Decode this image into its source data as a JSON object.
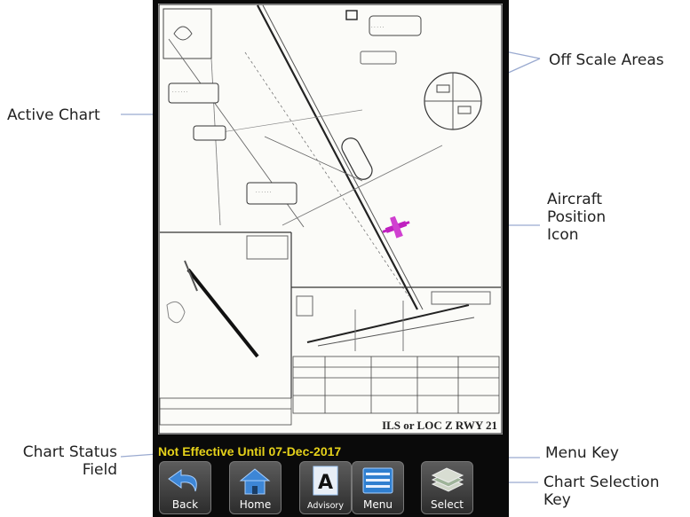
{
  "callouts": {
    "active_chart": "Active Chart",
    "off_scale_areas": "Off Scale Areas",
    "aircraft_position_icon": [
      "Aircraft",
      "Position",
      "Icon"
    ],
    "chart_status_field": [
      "Chart Status",
      "Field"
    ],
    "menu_key": "Menu Key",
    "chart_selection_key": [
      "Chart Selection",
      "Key"
    ]
  },
  "chart": {
    "title": "ILS or LOC Z RWY 21"
  },
  "status_field": "Not Effective Until 07-Dec-2017",
  "keys": [
    {
      "label": "Back",
      "icon": "back-arrow-icon"
    },
    {
      "label": "Home",
      "icon": "home-icon"
    },
    {
      "label": "Advisory",
      "icon": "advisory-icon"
    },
    {
      "label": "Menu",
      "icon": "menu-list-icon"
    },
    {
      "label": "Select",
      "icon": "chart-stack-icon"
    }
  ],
  "colors": {
    "status_text": "#e6d21a",
    "aircraft": "#c020c0",
    "menu_icon": "#2f7fd0",
    "key_face": "#3a3a3a",
    "leader_line": "#9aaad0"
  }
}
